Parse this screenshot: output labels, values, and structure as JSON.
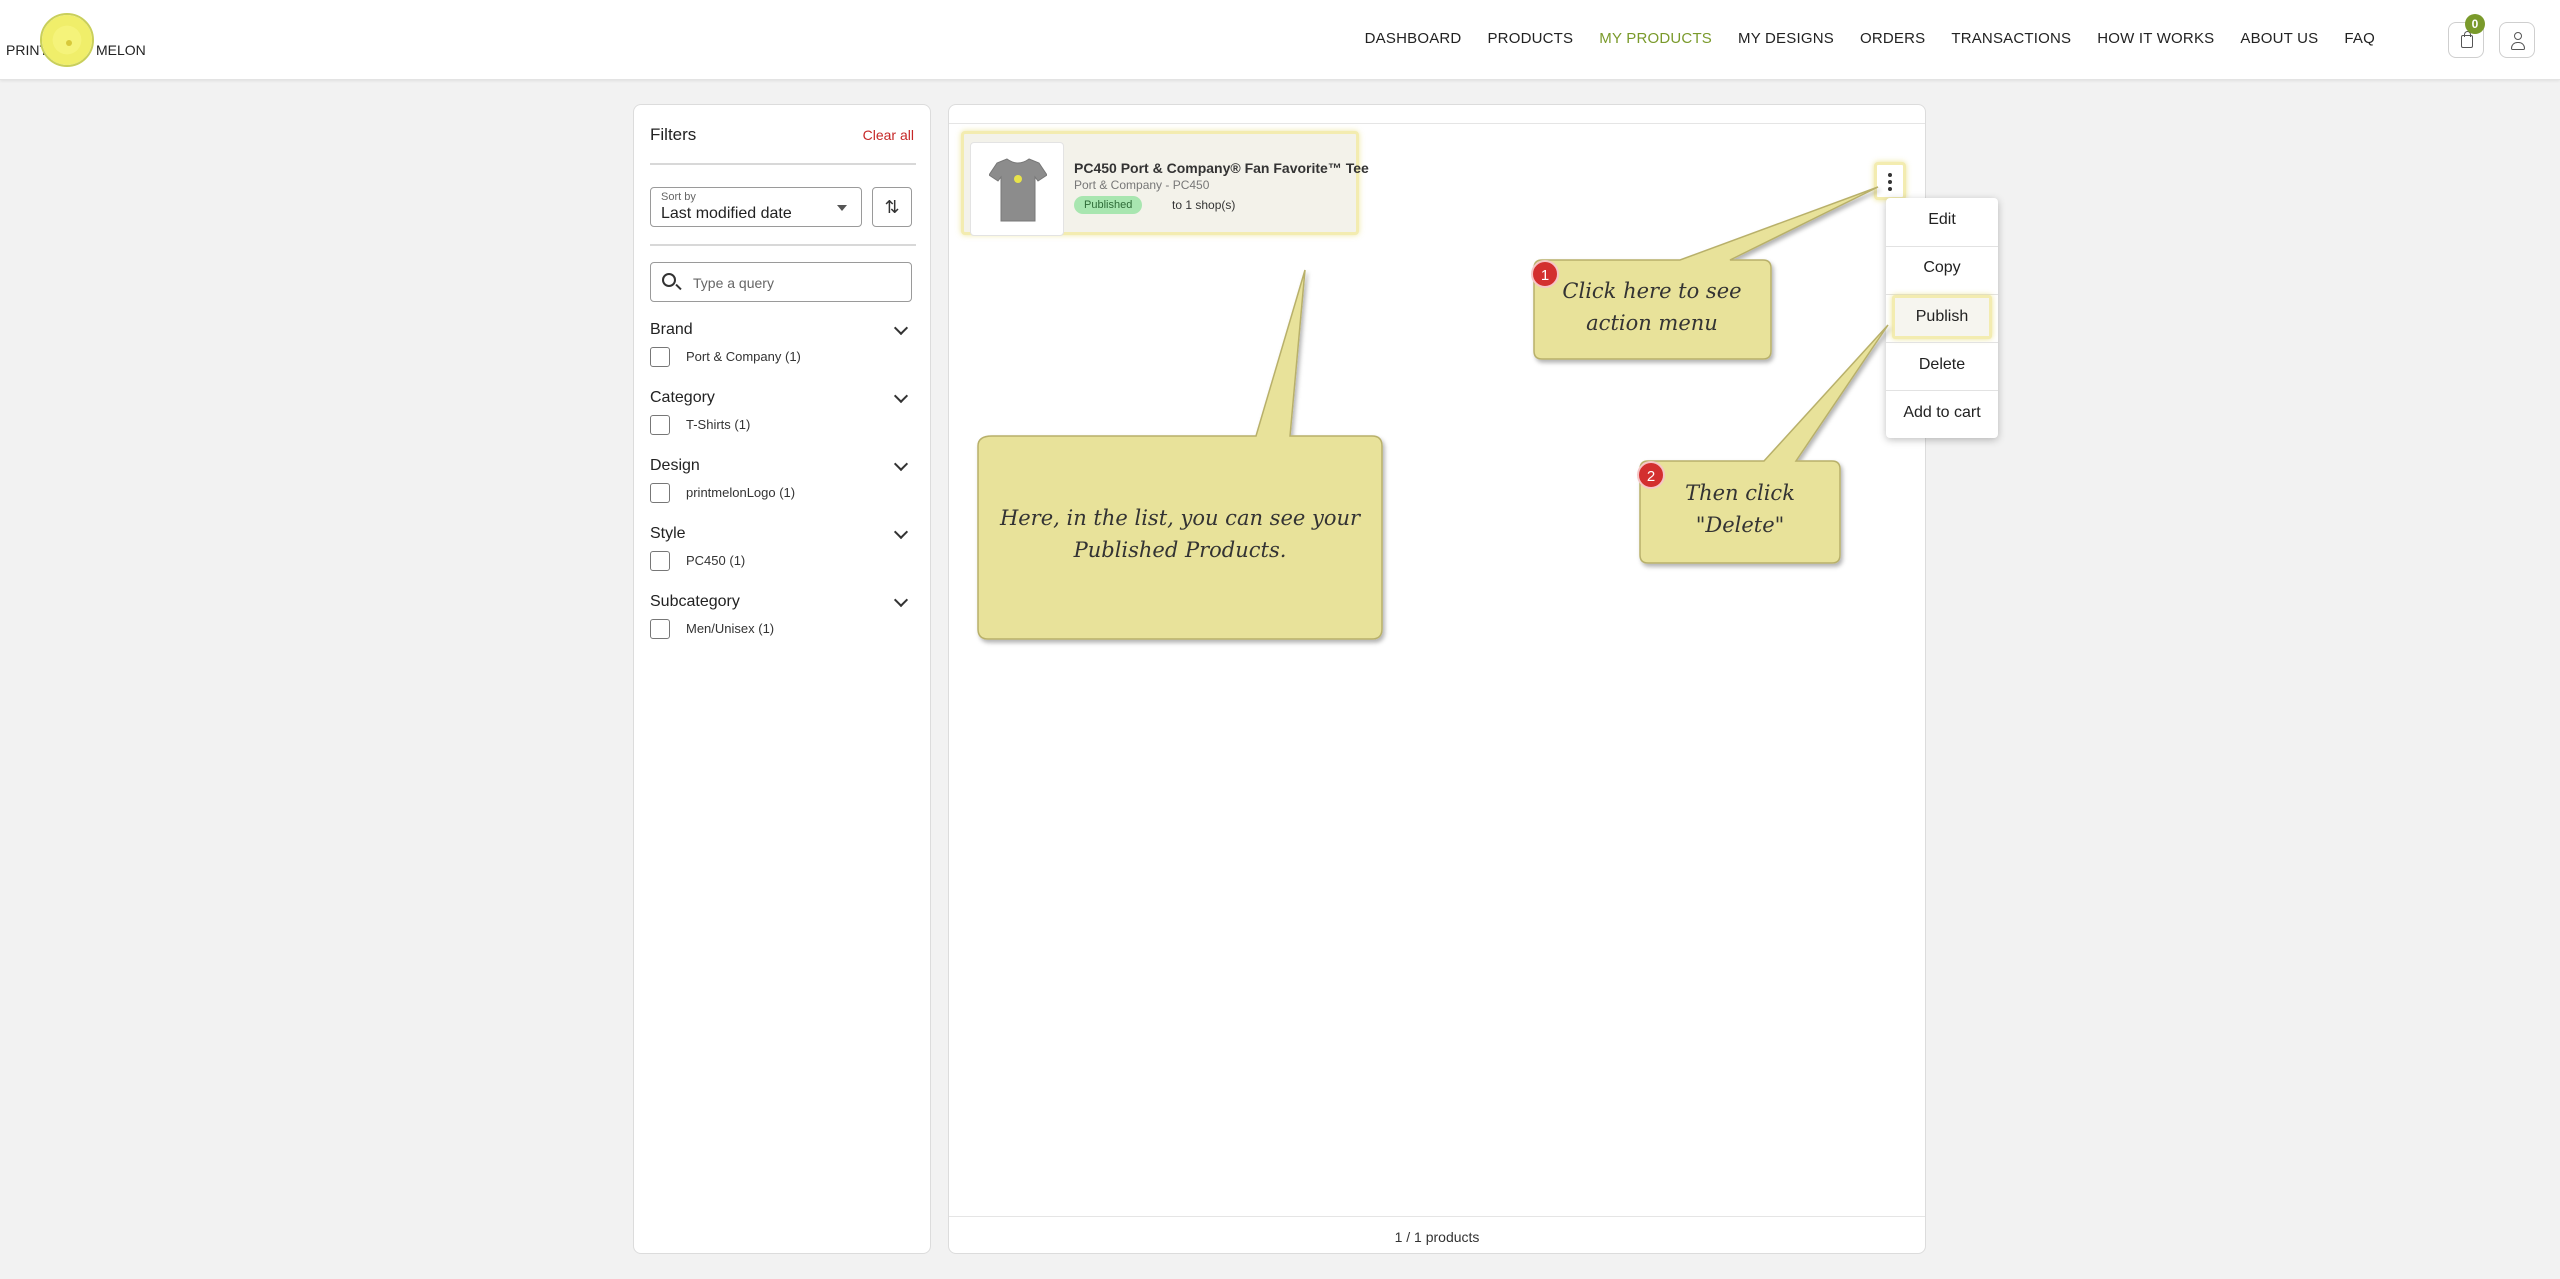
{
  "header": {
    "logo_left": "PRINT",
    "logo_right": "MELON",
    "nav": [
      "DASHBOARD",
      "PRODUCTS",
      "MY PRODUCTS",
      "MY DESIGNS",
      "ORDERS",
      "TRANSACTIONS",
      "HOW IT WORKS",
      "ABOUT US",
      "FAQ"
    ],
    "active_nav": "MY PRODUCTS",
    "cart_count": "0"
  },
  "filters": {
    "title": "Filters",
    "clear_all": "Clear all",
    "sort_label": "Sort by",
    "sort_value": "Last modified date",
    "search_placeholder": "Type a query",
    "groups": [
      {
        "title": "Brand",
        "option": "Port & Company (1)"
      },
      {
        "title": "Category",
        "option": "T-Shirts (1)"
      },
      {
        "title": "Design",
        "option": "printmelonLogo (1)"
      },
      {
        "title": "Style",
        "option": "PC450 (1)"
      },
      {
        "title": "Subcategory",
        "option": "Men/Unisex (1)"
      }
    ]
  },
  "product": {
    "name": "PC450 Port & Company® Fan Favorite™ Tee",
    "subtitle": "Port & Company - PC450",
    "status": "Published",
    "shops": "to 1 shop(s)"
  },
  "action_menu": {
    "items": [
      "Edit",
      "Copy",
      "Publish",
      "Delete",
      "Add to cart"
    ],
    "highlighted": "Publish"
  },
  "pagination": {
    "count": "1 / 1 products"
  },
  "callouts": {
    "list": "Here, in the list, you can see your Published Products.",
    "step1_number": "1",
    "step1": "Click here to see action menu",
    "step2_number": "2",
    "step2": "Then click \"Delete\""
  },
  "colors": {
    "accent": "#7a9a2b",
    "callout_fill": "#e8e29a",
    "callout_stroke": "#b8b06a",
    "danger": "#c62828",
    "published": "#a8e6b0"
  }
}
